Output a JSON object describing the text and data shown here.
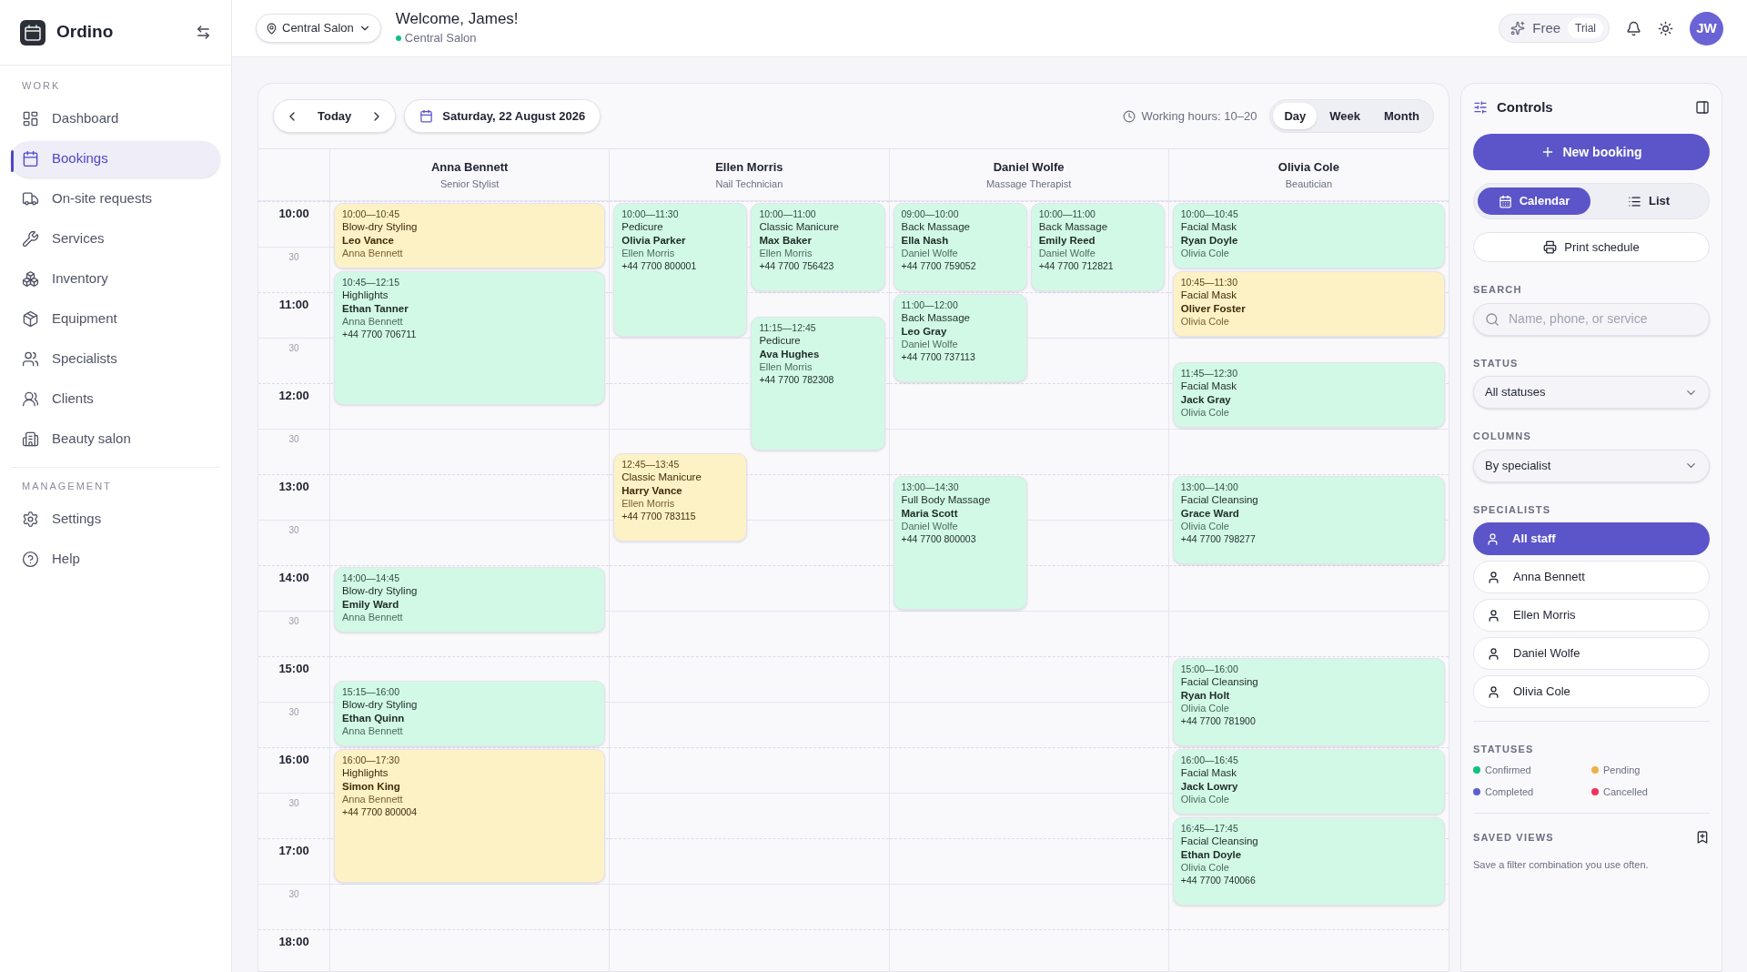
{
  "app": {
    "name": "Ordino"
  },
  "sidebar": {
    "sections": [
      {
        "title": "WORK",
        "items": [
          {
            "label": "Dashboard",
            "selected": false
          },
          {
            "label": "Bookings",
            "selected": true
          },
          {
            "label": "On-site requests",
            "selected": false
          },
          {
            "label": "Services",
            "selected": false
          },
          {
            "label": "Inventory",
            "selected": false
          },
          {
            "label": "Equipment",
            "selected": false
          },
          {
            "label": "Specialists",
            "selected": false
          },
          {
            "label": "Clients",
            "selected": false
          },
          {
            "label": "Beauty salon",
            "selected": false
          }
        ]
      },
      {
        "title": "MANAGEMENT",
        "items": [
          {
            "label": "Settings",
            "selected": false
          },
          {
            "label": "Help",
            "selected": false
          }
        ]
      }
    ]
  },
  "header": {
    "location": "Central Salon",
    "greeting": "Welcome, James!",
    "subtitle": "Central Salon",
    "plan": "Free",
    "plan_badge": "Trial",
    "avatar": "JW"
  },
  "toolbar": {
    "today": "Today",
    "date": "Saturday, 22 August 2026",
    "working_hours": "Working hours: 10–20",
    "views": [
      {
        "label": "Day",
        "selected": true
      },
      {
        "label": "Week",
        "selected": false
      },
      {
        "label": "Month",
        "selected": false
      }
    ]
  },
  "time_slots": [
    "10:00",
    "30",
    "11:00",
    "30",
    "12:00",
    "30",
    "13:00",
    "30",
    "14:00",
    "30",
    "15:00",
    "30",
    "16:00",
    "30",
    "17:00",
    "30",
    "18:00"
  ],
  "specialists": [
    {
      "name": "Anna Bennett",
      "role": "Senior Stylist",
      "bookings": [
        {
          "time": "10:00—10:45",
          "service": "Blow-dry Styling",
          "client": "Leo Vance",
          "staff": "Anna Bennett",
          "pending": true
        },
        {
          "time": "10:45—12:15",
          "service": "Highlights",
          "client": "Ethan Tanner",
          "staff": "Anna Bennett",
          "phone": "+44 7700 706711",
          "pending": false
        },
        {
          "time": "14:00—14:45",
          "service": "Blow-dry Styling",
          "client": "Emily Ward",
          "staff": "Anna Bennett",
          "pending": false
        },
        {
          "time": "15:15—16:00",
          "service": "Blow-dry Styling",
          "client": "Ethan Quinn",
          "staff": "Anna Bennett",
          "pending": false
        },
        {
          "time": "16:00—17:30",
          "service": "Highlights",
          "client": "Simon King",
          "staff": "Anna Bennett",
          "phone": "+44 7700 800004",
          "pending": true
        }
      ]
    },
    {
      "name": "Ellen Morris",
      "role": "Nail Technician",
      "bookings": [
        {
          "time": "10:00—11:30",
          "service": "Pedicure",
          "client": "Olivia Parker",
          "staff": "Ellen Morris",
          "phone": "+44 7700 800001",
          "pending": false
        },
        {
          "time": "10:00—11:00",
          "service": "Classic Manicure",
          "client": "Max Baker",
          "staff": "Ellen Morris",
          "phone": "+44 7700 756423",
          "pending": false
        },
        {
          "time": "11:15—12:45",
          "service": "Pedicure",
          "client": "Ava Hughes",
          "staff": "Ellen Morris",
          "phone": "+44 7700 782308",
          "pending": false
        },
        {
          "time": "12:45—13:45",
          "service": "Classic Manicure",
          "client": "Harry Vance",
          "staff": "Ellen Morris",
          "phone": "+44 7700 783115",
          "pending": true
        }
      ]
    },
    {
      "name": "Daniel Wolfe",
      "role": "Massage Therapist",
      "bookings": [
        {
          "time": "09:00—10:00",
          "service": "Back Massage",
          "client": "Ella Nash",
          "staff": "Daniel Wolfe",
          "phone": "+44 7700 759052",
          "pending": false
        },
        {
          "time": "10:00—11:00",
          "service": "Back Massage",
          "client": "Emily Reed",
          "staff": "Daniel Wolfe",
          "phone": "+44 7700 712821",
          "pending": false
        },
        {
          "time": "11:00—12:00",
          "service": "Back Massage",
          "client": "Leo Gray",
          "staff": "Daniel Wolfe",
          "phone": "+44 7700 737113",
          "pending": false
        },
        {
          "time": "13:00—14:30",
          "service": "Full Body Massage",
          "client": "Maria Scott",
          "staff": "Daniel Wolfe",
          "phone": "+44 7700 800003",
          "pending": false
        }
      ]
    },
    {
      "name": "Olivia Cole",
      "role": "Beautician",
      "bookings": [
        {
          "time": "10:00—10:45",
          "service": "Facial Mask",
          "client": "Ryan Doyle",
          "staff": "Olivia Cole",
          "pending": false
        },
        {
          "time": "10:45—11:30",
          "service": "Facial Mask",
          "client": "Oliver Foster",
          "staff": "Olivia Cole",
          "pending": true
        },
        {
          "time": "11:45—12:30",
          "service": "Facial Mask",
          "client": "Jack Gray",
          "staff": "Olivia Cole",
          "pending": false
        },
        {
          "time": "13:00—14:00",
          "service": "Facial Cleansing",
          "client": "Grace Ward",
          "staff": "Olivia Cole",
          "phone": "+44 7700 798277",
          "pending": false
        },
        {
          "time": "15:00—16:00",
          "service": "Facial Cleansing",
          "client": "Ryan Holt",
          "staff": "Olivia Cole",
          "phone": "+44 7700 781900",
          "pending": false
        },
        {
          "time": "16:00—16:45",
          "service": "Facial Mask",
          "client": "Jack Lowry",
          "staff": "Olivia Cole",
          "pending": false
        },
        {
          "time": "16:45—17:45",
          "service": "Facial Cleansing",
          "client": "Ethan Doyle",
          "staff": "Olivia Cole",
          "phone": "+44 7700 740066",
          "pending": false
        }
      ]
    }
  ],
  "controls": {
    "title": "Controls",
    "new_booking": "New booking",
    "modes": [
      {
        "label": "Calendar",
        "selected": true
      },
      {
        "label": "List",
        "selected": false
      }
    ],
    "print": "Print schedule",
    "search_label": "SEARCH",
    "search": {
      "placeholder": "Name, phone, or service"
    },
    "status_label": "STATUS",
    "status_value": "All statuses",
    "columns_label": "COLUMNS",
    "columns_value": "By specialist",
    "specialists_label": "SPECIALISTS",
    "specialist_filters": [
      {
        "label": "All staff",
        "selected": true
      },
      {
        "label": "Anna Bennett",
        "selected": false
      },
      {
        "label": "Ellen Morris",
        "selected": false
      },
      {
        "label": "Daniel Wolfe",
        "selected": false
      },
      {
        "label": "Olivia Cole",
        "selected": false
      }
    ],
    "statuses_label": "STATUSES",
    "legend": [
      {
        "label": "Confirmed",
        "color": "#10c27f"
      },
      {
        "label": "Pending",
        "color": "#eeb04a"
      },
      {
        "label": "Completed",
        "color": "#5b5fd0"
      },
      {
        "label": "Cancelled",
        "color": "#f0325a"
      }
    ],
    "saved_views_label": "SAVED VIEWS",
    "saved_views_hint": "Save a filter combination you use often."
  }
}
